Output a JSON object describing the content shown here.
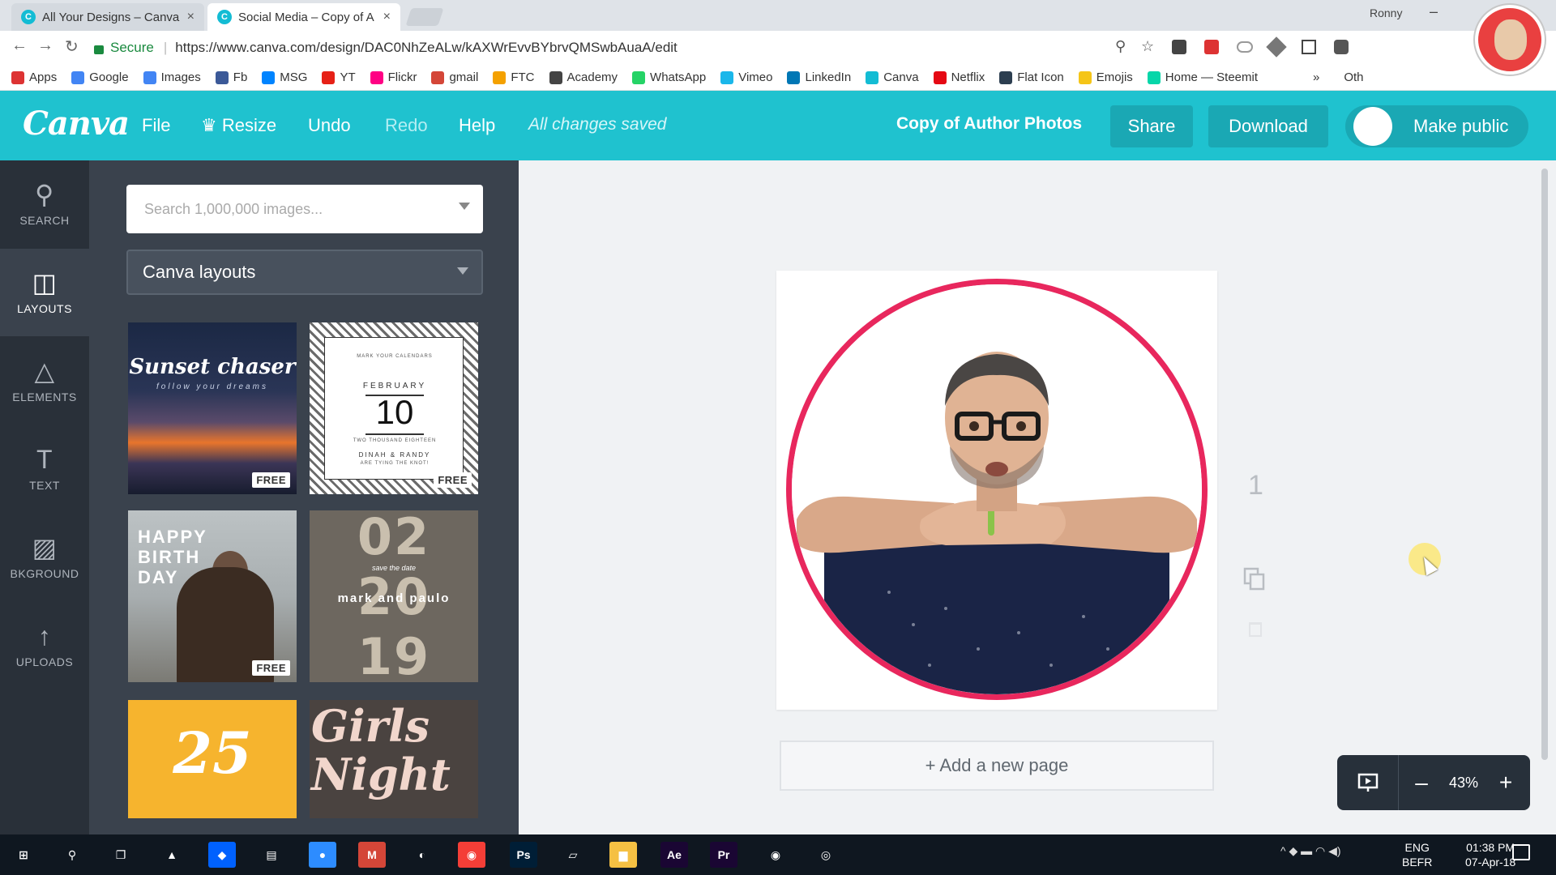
{
  "browser": {
    "tabs": [
      {
        "title": "All Your Designs – Canva",
        "favicon": "C",
        "close": "×"
      },
      {
        "title": "Social Media – Copy of A",
        "favicon": "C",
        "close": "×"
      }
    ],
    "profile_name": "Ronny",
    "minimize": "–",
    "nav": {
      "back": "←",
      "forward": "→",
      "reload": "↻"
    },
    "secure_label": "Secure",
    "address_sep": "|",
    "url": "https://www.canva.com/design/DAC0NhZeALw/kAXWrEvvBYbrvQMSwbAuaA/edit",
    "omni_icons": {
      "zoom": "⚲",
      "star": "☆"
    },
    "bookmarks": [
      {
        "label": "Apps",
        "color": "#d33"
      },
      {
        "label": "Google",
        "color": "#4285f4"
      },
      {
        "label": "Images",
        "color": "#4285f4"
      },
      {
        "label": "Fb",
        "color": "#3b5998"
      },
      {
        "label": "MSG",
        "color": "#0084ff"
      },
      {
        "label": "YT",
        "color": "#e62117"
      },
      {
        "label": "Flickr",
        "color": "#ff0084"
      },
      {
        "label": "gmail",
        "color": "#d44638"
      },
      {
        "label": "FTC",
        "color": "#f4a100"
      },
      {
        "label": "Academy",
        "color": "#444"
      },
      {
        "label": "WhatsApp",
        "color": "#25d366"
      },
      {
        "label": "Vimeo",
        "color": "#1ab7ea"
      },
      {
        "label": "LinkedIn",
        "color": "#0077b5"
      },
      {
        "label": "Canva",
        "color": "#13bcd4"
      },
      {
        "label": "Netflix",
        "color": "#e50914"
      },
      {
        "label": "Flat Icon",
        "color": "#2c3e50"
      },
      {
        "label": "Emojis",
        "color": "#f5c518"
      },
      {
        "label": "Home — Steemit",
        "color": "#06d6a9"
      }
    ],
    "bookmarks_more": "»",
    "other_bookmarks": "Oth"
  },
  "canva": {
    "logo": "Canva",
    "menu": {
      "file": "File",
      "resize": "Resize",
      "resize_icon": "♛",
      "undo": "Undo",
      "redo": "Redo",
      "help": "Help"
    },
    "status": "All changes saved",
    "design_title": "Copy of Author Photos",
    "share": "Share",
    "download": "Download",
    "make_public": "Make public",
    "accent": "#1fc2cf"
  },
  "leftnav": [
    {
      "label": "SEARCH",
      "icon": "⚲"
    },
    {
      "label": "LAYOUTS",
      "icon": "◫"
    },
    {
      "label": "ELEMENTS",
      "icon": "△"
    },
    {
      "label": "TEXT",
      "icon": "T"
    },
    {
      "label": "BKGROUND",
      "icon": "▨"
    },
    {
      "label": "UPLOADS",
      "icon": "↑"
    }
  ],
  "panel": {
    "search_placeholder": "Search 1,000,000 images...",
    "category": "Canva layouts",
    "free_badge": "FREE",
    "templates": {
      "sunset": {
        "title": "Sunset chaser",
        "sub": "follow your dreams"
      },
      "calendar": {
        "top": "MARK YOUR CALENDARS",
        "month": "FEBRUARY",
        "day": "10",
        "year": "TWO THOUSAND EIGHTEEN",
        "names": "DINAH & RANDY",
        "tag": "ARE TYING THE KNOT!"
      },
      "birthday": {
        "text": "HAPPY BIRTH DAY"
      },
      "wedding": {
        "n1": "02",
        "n2": "20",
        "n3": "19",
        "names": "mark and paulo",
        "save": "save the date"
      },
      "class": {
        "number": "25"
      },
      "girls": {
        "text": "Girls Night"
      }
    }
  },
  "canvas": {
    "frame_color": "#e8275d",
    "page_number": "1",
    "add_page": "+ Add a new page",
    "zoom": {
      "minus": "–",
      "value": "43%",
      "plus": "+"
    }
  },
  "taskbar": {
    "apps": [
      {
        "name": "windows-start",
        "label": "⊞",
        "bg": "transparent"
      },
      {
        "name": "search",
        "label": "⚲",
        "bg": "transparent"
      },
      {
        "name": "task-view",
        "label": "❐",
        "bg": "transparent"
      },
      {
        "name": "vlc",
        "label": "▲",
        "bg": "transparent"
      },
      {
        "name": "dropbox",
        "label": "◆",
        "bg": "#0061fe"
      },
      {
        "name": "explorer-app",
        "label": "▤",
        "bg": "transparent"
      },
      {
        "name": "zoom",
        "label": "●",
        "bg": "#2d8cff"
      },
      {
        "name": "gmail",
        "label": "M",
        "bg": "#d44638"
      },
      {
        "name": "chrome-canary",
        "label": "◐",
        "bg": "transparent"
      },
      {
        "name": "pocketcasts",
        "label": "◉",
        "bg": "#f43e37"
      },
      {
        "name": "photoshop",
        "label": "Ps",
        "bg": "#001e36"
      },
      {
        "name": "notes",
        "label": "▱",
        "bg": "transparent"
      },
      {
        "name": "file-explorer",
        "label": "▆",
        "bg": "#f5c043"
      },
      {
        "name": "after-effects",
        "label": "Ae",
        "bg": "#1a0633"
      },
      {
        "name": "premiere",
        "label": "Pr",
        "bg": "#1a0633"
      },
      {
        "name": "chrome",
        "label": "◉",
        "bg": "transparent"
      },
      {
        "name": "obs",
        "label": "◎",
        "bg": "transparent"
      }
    ],
    "tray": "^  ◆  ▬  ◠  ◀)",
    "lang": [
      "ENG",
      "BEFR"
    ],
    "time": "01:38 PM",
    "date": "07-Apr-18"
  }
}
